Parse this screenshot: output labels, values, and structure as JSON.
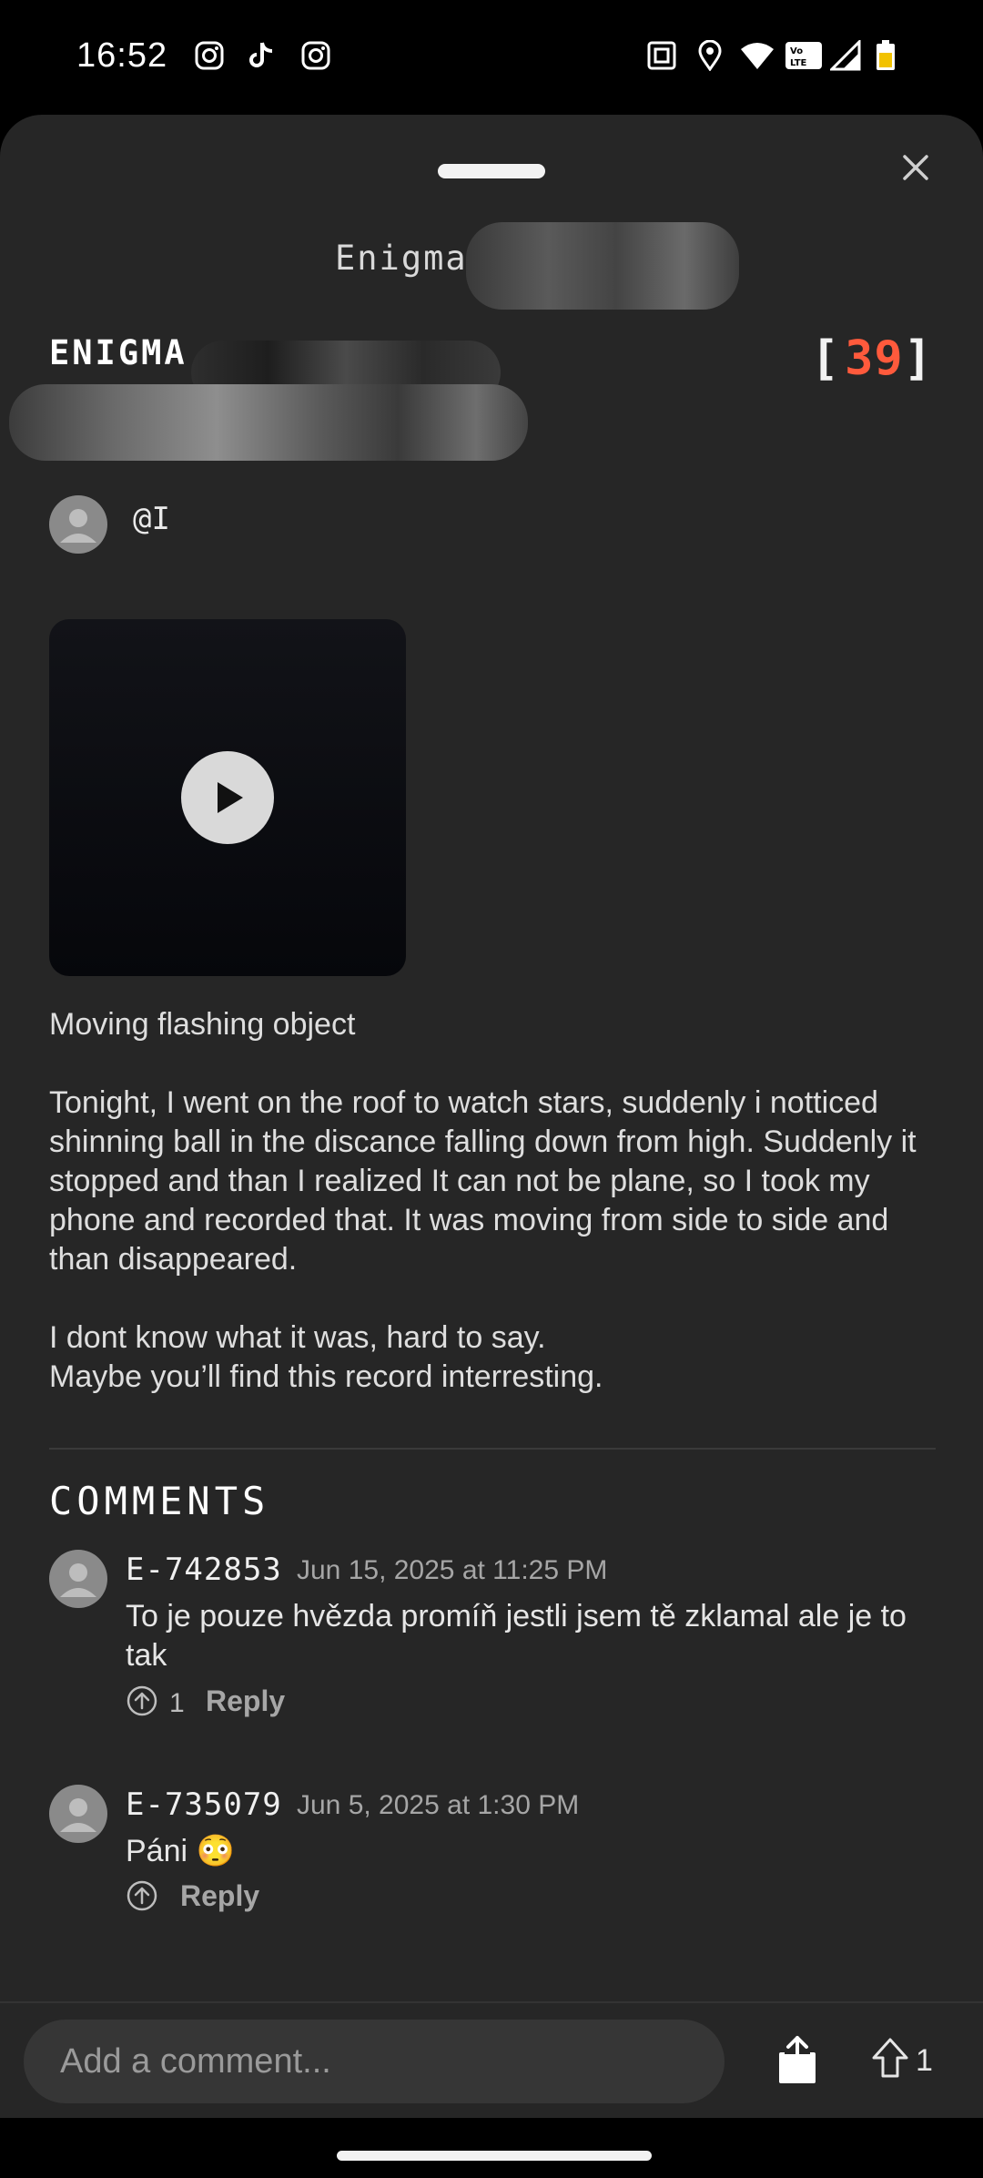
{
  "status_bar": {
    "time": "16:52",
    "left_icons": [
      "instagram-icon",
      "tiktok-icon",
      "instagram-icon"
    ],
    "right_icons": [
      "nfc-icon",
      "location-icon",
      "wifi-icon",
      "volte-icon",
      "signal-icon",
      "battery-icon"
    ]
  },
  "sheet": {
    "title": "Enigma",
    "close_icon": "close-icon"
  },
  "post": {
    "title": "ENIGMA",
    "score": "39",
    "score_open": "[",
    "score_close": "]",
    "author": "@I",
    "description": "Moving flashing object\n\nTonight, I went on the roof to watch stars, suddenly i notticed shinning ball in the discance falling down from high. Suddenly it stopped and than I realized It can not be plane, so I took my phone and recorded that. It was moving from side to side and than disappeared.\n\nI dont know what it was, hard to say.\nMaybe you’ll find this record interresting."
  },
  "comments": {
    "heading": "COMMENTS",
    "items": [
      {
        "user": "E-742853",
        "date": "Jun 15, 2025 at 11:25 PM",
        "text": "To je pouze hvězda promíň jestli jsem tě zklamal ale je to tak",
        "upvotes": "1",
        "reply_label": "Reply"
      },
      {
        "user": "E-735079",
        "date": "Jun 5, 2025 at 1:30 PM",
        "text": "Páni 😳",
        "upvotes": "",
        "reply_label": "Reply"
      }
    ]
  },
  "bottom_bar": {
    "comment_placeholder": "Add a comment...",
    "upvote_count": "1"
  },
  "colors": {
    "sheet_bg": "#262626",
    "accent": "#ff5a3c"
  }
}
